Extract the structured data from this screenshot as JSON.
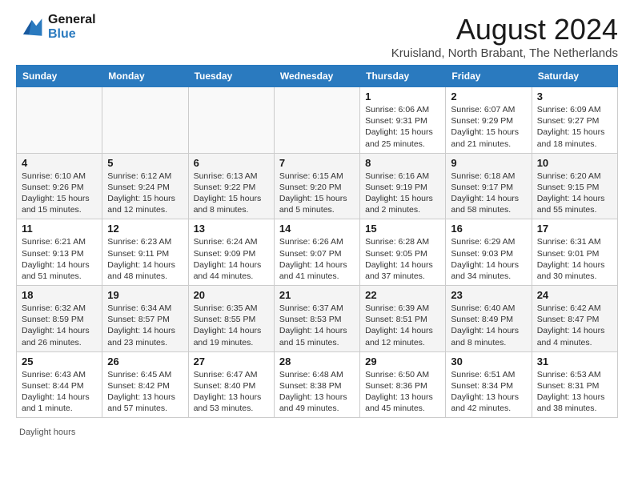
{
  "logo": {
    "line1": "General",
    "line2": "Blue"
  },
  "title": "August 2024",
  "subtitle": "Kruisland, North Brabant, The Netherlands",
  "days_of_week": [
    "Sunday",
    "Monday",
    "Tuesday",
    "Wednesday",
    "Thursday",
    "Friday",
    "Saturday"
  ],
  "weeks": [
    [
      {
        "day": "",
        "info": ""
      },
      {
        "day": "",
        "info": ""
      },
      {
        "day": "",
        "info": ""
      },
      {
        "day": "",
        "info": ""
      },
      {
        "day": "1",
        "info": "Sunrise: 6:06 AM\nSunset: 9:31 PM\nDaylight: 15 hours and 25 minutes."
      },
      {
        "day": "2",
        "info": "Sunrise: 6:07 AM\nSunset: 9:29 PM\nDaylight: 15 hours and 21 minutes."
      },
      {
        "day": "3",
        "info": "Sunrise: 6:09 AM\nSunset: 9:27 PM\nDaylight: 15 hours and 18 minutes."
      }
    ],
    [
      {
        "day": "4",
        "info": "Sunrise: 6:10 AM\nSunset: 9:26 PM\nDaylight: 15 hours and 15 minutes."
      },
      {
        "day": "5",
        "info": "Sunrise: 6:12 AM\nSunset: 9:24 PM\nDaylight: 15 hours and 12 minutes."
      },
      {
        "day": "6",
        "info": "Sunrise: 6:13 AM\nSunset: 9:22 PM\nDaylight: 15 hours and 8 minutes."
      },
      {
        "day": "7",
        "info": "Sunrise: 6:15 AM\nSunset: 9:20 PM\nDaylight: 15 hours and 5 minutes."
      },
      {
        "day": "8",
        "info": "Sunrise: 6:16 AM\nSunset: 9:19 PM\nDaylight: 15 hours and 2 minutes."
      },
      {
        "day": "9",
        "info": "Sunrise: 6:18 AM\nSunset: 9:17 PM\nDaylight: 14 hours and 58 minutes."
      },
      {
        "day": "10",
        "info": "Sunrise: 6:20 AM\nSunset: 9:15 PM\nDaylight: 14 hours and 55 minutes."
      }
    ],
    [
      {
        "day": "11",
        "info": "Sunrise: 6:21 AM\nSunset: 9:13 PM\nDaylight: 14 hours and 51 minutes."
      },
      {
        "day": "12",
        "info": "Sunrise: 6:23 AM\nSunset: 9:11 PM\nDaylight: 14 hours and 48 minutes."
      },
      {
        "day": "13",
        "info": "Sunrise: 6:24 AM\nSunset: 9:09 PM\nDaylight: 14 hours and 44 minutes."
      },
      {
        "day": "14",
        "info": "Sunrise: 6:26 AM\nSunset: 9:07 PM\nDaylight: 14 hours and 41 minutes."
      },
      {
        "day": "15",
        "info": "Sunrise: 6:28 AM\nSunset: 9:05 PM\nDaylight: 14 hours and 37 minutes."
      },
      {
        "day": "16",
        "info": "Sunrise: 6:29 AM\nSunset: 9:03 PM\nDaylight: 14 hours and 34 minutes."
      },
      {
        "day": "17",
        "info": "Sunrise: 6:31 AM\nSunset: 9:01 PM\nDaylight: 14 hours and 30 minutes."
      }
    ],
    [
      {
        "day": "18",
        "info": "Sunrise: 6:32 AM\nSunset: 8:59 PM\nDaylight: 14 hours and 26 minutes."
      },
      {
        "day": "19",
        "info": "Sunrise: 6:34 AM\nSunset: 8:57 PM\nDaylight: 14 hours and 23 minutes."
      },
      {
        "day": "20",
        "info": "Sunrise: 6:35 AM\nSunset: 8:55 PM\nDaylight: 14 hours and 19 minutes."
      },
      {
        "day": "21",
        "info": "Sunrise: 6:37 AM\nSunset: 8:53 PM\nDaylight: 14 hours and 15 minutes."
      },
      {
        "day": "22",
        "info": "Sunrise: 6:39 AM\nSunset: 8:51 PM\nDaylight: 14 hours and 12 minutes."
      },
      {
        "day": "23",
        "info": "Sunrise: 6:40 AM\nSunset: 8:49 PM\nDaylight: 14 hours and 8 minutes."
      },
      {
        "day": "24",
        "info": "Sunrise: 6:42 AM\nSunset: 8:47 PM\nDaylight: 14 hours and 4 minutes."
      }
    ],
    [
      {
        "day": "25",
        "info": "Sunrise: 6:43 AM\nSunset: 8:44 PM\nDaylight: 14 hours and 1 minute."
      },
      {
        "day": "26",
        "info": "Sunrise: 6:45 AM\nSunset: 8:42 PM\nDaylight: 13 hours and 57 minutes."
      },
      {
        "day": "27",
        "info": "Sunrise: 6:47 AM\nSunset: 8:40 PM\nDaylight: 13 hours and 53 minutes."
      },
      {
        "day": "28",
        "info": "Sunrise: 6:48 AM\nSunset: 8:38 PM\nDaylight: 13 hours and 49 minutes."
      },
      {
        "day": "29",
        "info": "Sunrise: 6:50 AM\nSunset: 8:36 PM\nDaylight: 13 hours and 45 minutes."
      },
      {
        "day": "30",
        "info": "Sunrise: 6:51 AM\nSunset: 8:34 PM\nDaylight: 13 hours and 42 minutes."
      },
      {
        "day": "31",
        "info": "Sunrise: 6:53 AM\nSunset: 8:31 PM\nDaylight: 13 hours and 38 minutes."
      }
    ]
  ],
  "footer": {
    "daylight_label": "Daylight hours"
  }
}
